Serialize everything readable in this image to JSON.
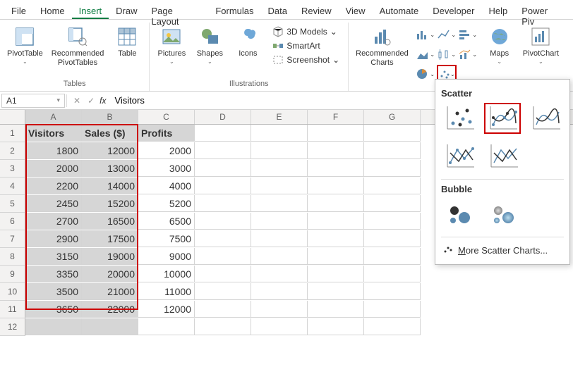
{
  "tabs": [
    "File",
    "Home",
    "Insert",
    "Draw",
    "Page Layout",
    "Formulas",
    "Data",
    "Review",
    "View",
    "Automate",
    "Developer",
    "Help",
    "Power Piv"
  ],
  "active_tab": "Insert",
  "ribbon": {
    "tables_group": "Tables",
    "pivot_table": "PivotTable",
    "recommended_pivot": "Recommended\nPivotTables",
    "table": "Table",
    "illustrations_group": "Illustrations",
    "pictures": "Pictures",
    "shapes": "Shapes",
    "icons": "Icons",
    "models3d": "3D Models",
    "smartart": "SmartArt",
    "screenshot": "Screenshot",
    "recommended_charts": "Recommended\nCharts",
    "maps": "Maps",
    "pivotchart": "PivotChart"
  },
  "dropdown": {
    "scatter_label": "Scatter",
    "bubble_label": "Bubble",
    "more_link": "More Scatter Charts..."
  },
  "name_box": "A1",
  "formula_value": "Visitors",
  "columns": [
    "A",
    "B",
    "C",
    "D",
    "E",
    "F",
    "G"
  ],
  "headers": [
    "Visitors",
    "Sales ($)",
    "Profits"
  ],
  "rows": [
    [
      1800,
      12000,
      2000
    ],
    [
      2000,
      13000,
      3000
    ],
    [
      2200,
      14000,
      4000
    ],
    [
      2450,
      15200,
      5200
    ],
    [
      2700,
      16500,
      6500
    ],
    [
      2900,
      17500,
      7500
    ],
    [
      3150,
      19000,
      9000
    ],
    [
      3350,
      20000,
      10000
    ],
    [
      3500,
      21000,
      11000
    ],
    [
      3650,
      22000,
      12000
    ]
  ]
}
